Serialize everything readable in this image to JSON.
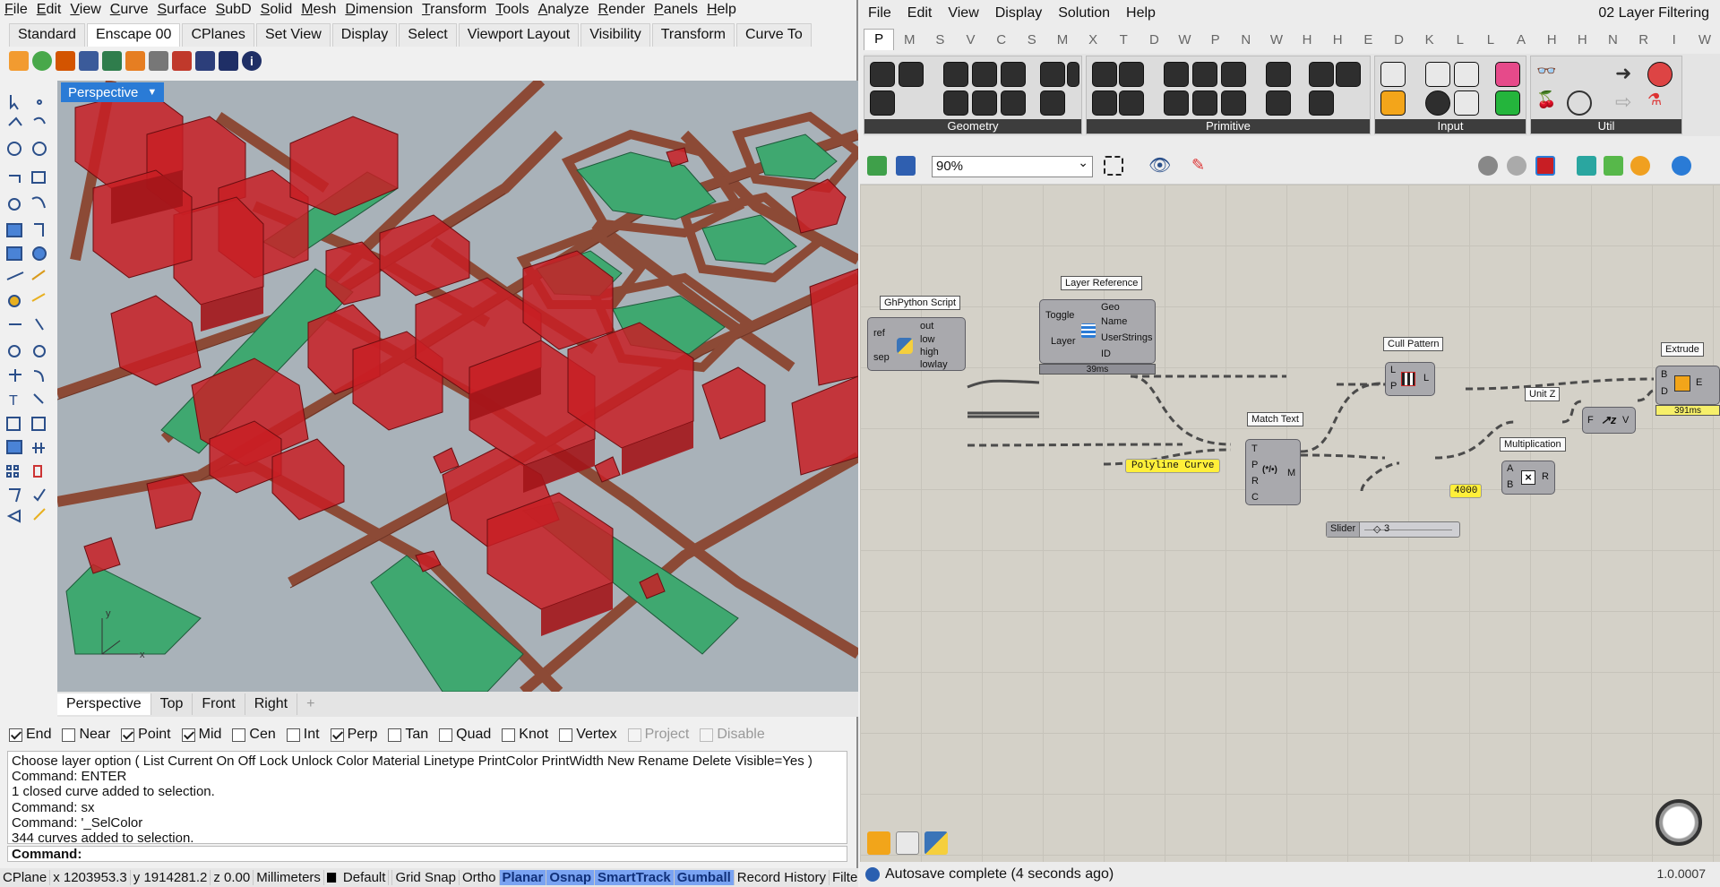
{
  "rhino": {
    "menu": [
      "File",
      "Edit",
      "View",
      "Curve",
      "Surface",
      "SubD",
      "Solid",
      "Mesh",
      "Dimension",
      "Transform",
      "Tools",
      "Analyze",
      "Render",
      "Panels",
      "Help"
    ],
    "tabs": [
      "Standard",
      "Enscape 00",
      "CPlanes",
      "Set View",
      "Display",
      "Select",
      "Viewport Layout",
      "Visibility",
      "Transform",
      "Curve To"
    ],
    "active_tab": "Enscape 00",
    "viewport_name": "Perspective",
    "viewport_tabs": [
      "Perspective",
      "Top",
      "Front",
      "Right"
    ],
    "osnaps": [
      {
        "label": "End",
        "checked": true
      },
      {
        "label": "Near",
        "checked": false
      },
      {
        "label": "Point",
        "checked": true
      },
      {
        "label": "Mid",
        "checked": true
      },
      {
        "label": "Cen",
        "checked": false
      },
      {
        "label": "Int",
        "checked": false
      },
      {
        "label": "Perp",
        "checked": true
      },
      {
        "label": "Tan",
        "checked": false
      },
      {
        "label": "Quad",
        "checked": false
      },
      {
        "label": "Knot",
        "checked": false
      },
      {
        "label": "Vertex",
        "checked": false
      },
      {
        "label": "Project",
        "checked": false,
        "disabled": true
      },
      {
        "label": "Disable",
        "checked": false,
        "disabled": true
      }
    ],
    "command_history": [
      "Choose layer option ( List  Current  On  Off  Lock  Unlock  Color  Material  Linetype  PrintColor  PrintWidth  New  Rename  Delete  Visible=Yes )",
      "Command: ENTER",
      "1 closed curve added to selection.",
      "Command: sx",
      "Command: '_SelColor",
      "344 curves added to selection."
    ],
    "command_prompt": "Command:",
    "status": {
      "cplane": "CPlane",
      "x": "x 1203953.3",
      "y": "y 1914281.2",
      "z": "z 0.00",
      "units": "Millimeters",
      "layer": "Default",
      "toggles": [
        {
          "label": "Grid Snap",
          "on": false
        },
        {
          "label": "Ortho",
          "on": false
        },
        {
          "label": "Planar",
          "on": true
        },
        {
          "label": "Osnap",
          "on": true
        },
        {
          "label": "SmartTrack",
          "on": true
        },
        {
          "label": "Gumball",
          "on": true
        },
        {
          "label": "Record History",
          "on": false
        },
        {
          "label": "Filter",
          "on": false
        }
      ]
    },
    "colors": {
      "building": "#c81e24",
      "road": "#8c4a36",
      "park": "#3fa870",
      "ground": "#a9b2b9"
    }
  },
  "gh": {
    "menu": [
      "File",
      "Edit",
      "View",
      "Display",
      "Solution",
      "Help"
    ],
    "title": "02 Layer Filtering",
    "category_tabs": [
      "P",
      "M",
      "S",
      "V",
      "C",
      "S",
      "M",
      "X",
      "T",
      "D",
      "W",
      "P",
      "N",
      "W",
      "H",
      "H",
      "E",
      "D",
      "K",
      "L",
      "L",
      "A",
      "H",
      "H",
      "N",
      "R",
      "I",
      "W"
    ],
    "ribbon_groups": [
      "Geometry",
      "Primitive",
      "Input",
      "Util"
    ],
    "zoom": "90%",
    "components": {
      "ghpython": {
        "title": "GhPython Script",
        "inputs": [
          "ref",
          "sep"
        ],
        "outputs": [
          "out",
          "low",
          "high",
          "lowlay"
        ]
      },
      "layer_ref": {
        "title": "Layer Reference",
        "inputs": [
          "Toggle",
          "Layer"
        ],
        "outputs": [
          "Geo",
          "Name",
          "UserStrings",
          "ID"
        ],
        "time": "39ms"
      },
      "match_text": {
        "title": "Match Text",
        "inputs": [
          "T",
          "P",
          "R",
          "C"
        ],
        "output": "M"
      },
      "cull": {
        "title": "Cull Pattern",
        "inputs": [
          "L",
          "P"
        ],
        "output": "L"
      },
      "mult": {
        "title": "Multiplication",
        "inputs": [
          "A",
          "B"
        ],
        "output": "R"
      },
      "unitz": {
        "title": "Unit Z",
        "input": "F",
        "output": "V"
      },
      "extrude": {
        "title": "Extrude",
        "inputs": [
          "B",
          "D"
        ],
        "output": "E",
        "time": "391ms"
      }
    },
    "panels": {
      "polyline": "Polyline Curve",
      "number": "4000"
    },
    "slider": {
      "label": "Slider",
      "value": "3"
    },
    "status": "Autosave complete (4 seconds ago)",
    "version": "1.0.0007"
  }
}
